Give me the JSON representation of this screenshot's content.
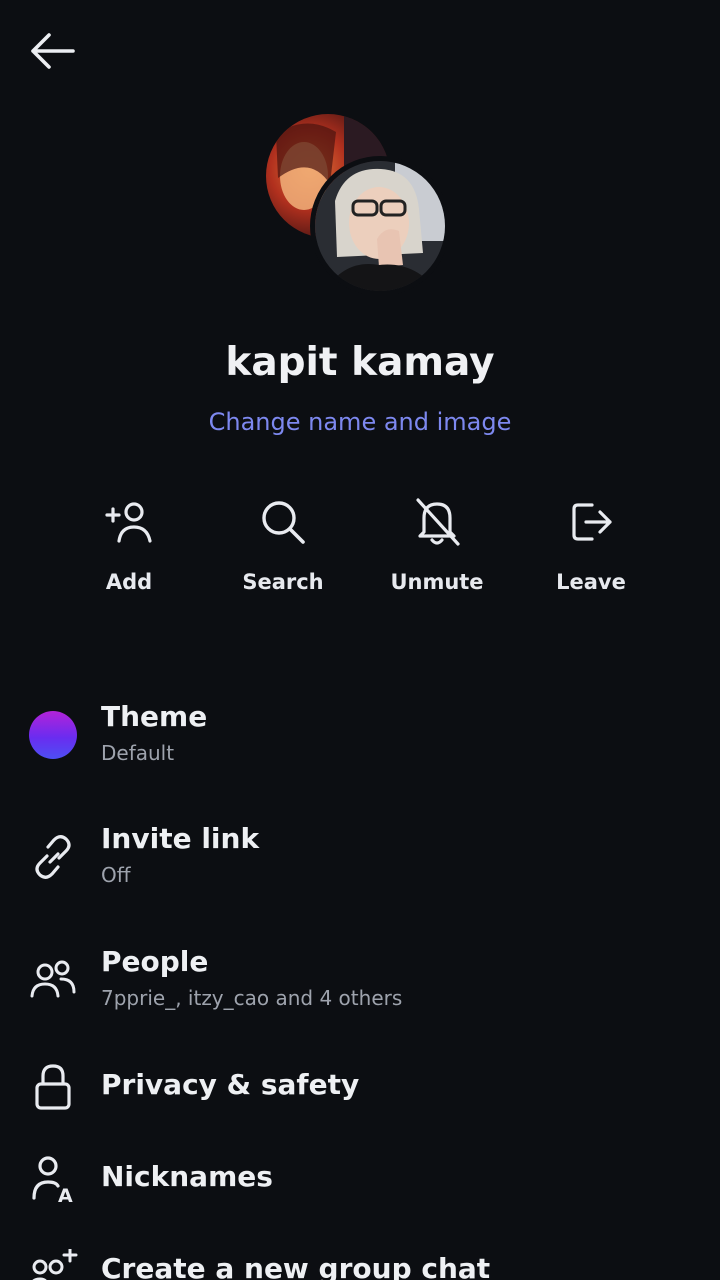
{
  "header": {
    "back_icon": "arrow-left-icon"
  },
  "group": {
    "name": "kapit kamay",
    "change_label": "Change name and image"
  },
  "actions": [
    {
      "label": "Add",
      "icon": "add-person-icon"
    },
    {
      "label": "Search",
      "icon": "search-icon"
    },
    {
      "label": "Unmute",
      "icon": "bell-off-icon"
    },
    {
      "label": "Leave",
      "icon": "leave-icon"
    }
  ],
  "settings": [
    {
      "title": "Theme",
      "subtitle": "Default",
      "icon": "theme-color-icon"
    },
    {
      "title": "Invite link",
      "subtitle": "Off",
      "icon": "link-icon"
    },
    {
      "title": "People",
      "subtitle": "7pprie_, itzy_cao and 4 others",
      "icon": "people-icon"
    },
    {
      "title": "Privacy & safety",
      "icon": "lock-icon"
    },
    {
      "title": "Nicknames",
      "icon": "nickname-icon"
    },
    {
      "title": "Create a new group chat",
      "icon": "new-group-icon"
    }
  ],
  "colors": {
    "background": "#0c0e12",
    "accent_link": "#7d88ef",
    "text_primary": "#eef0f3",
    "text_secondary": "#9ea3ad",
    "theme_gradient": [
      "#b323d8",
      "#4d4ff3"
    ]
  }
}
